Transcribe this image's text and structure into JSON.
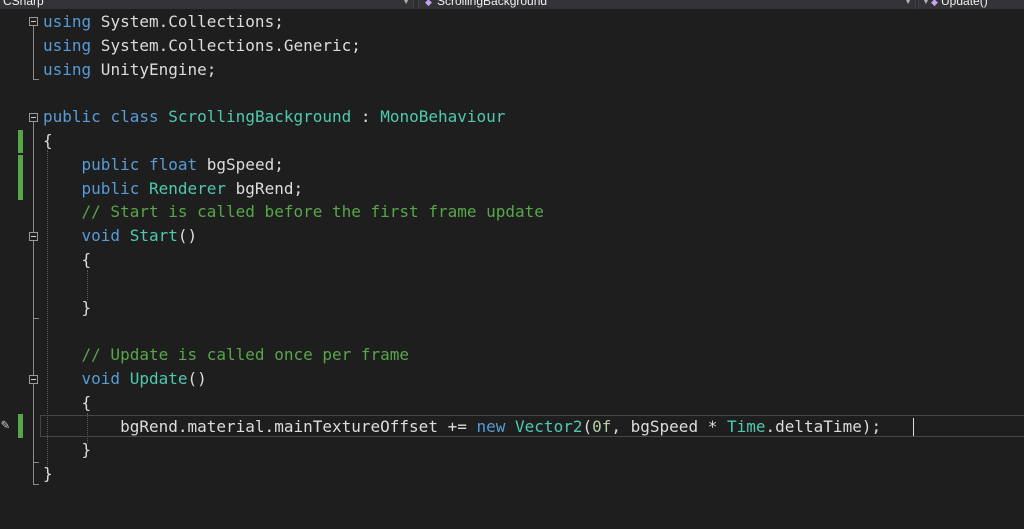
{
  "navbar": {
    "project": "CSharp",
    "class_member": "ScrollingBackground",
    "method": "Update()",
    "colors": {
      "background": "#2d2d30",
      "dropdown": "#333337"
    }
  },
  "editor": {
    "lines": [
      [
        {
          "t": "using",
          "c": "kw"
        },
        {
          "t": " System.Collections;"
        }
      ],
      [
        {
          "t": "using",
          "c": "kw"
        },
        {
          "t": " System.Collections.Generic;"
        }
      ],
      [
        {
          "t": "using",
          "c": "kw"
        },
        {
          "t": " UnityEngine;"
        }
      ],
      [],
      [
        {
          "t": "public",
          "c": "kw"
        },
        {
          "t": " "
        },
        {
          "t": "class",
          "c": "kw"
        },
        {
          "t": " "
        },
        {
          "t": "ScrollingBackground",
          "c": "ty"
        },
        {
          "t": " : "
        },
        {
          "t": "MonoBehaviour",
          "c": "ty"
        }
      ],
      [
        {
          "t": "{"
        }
      ],
      [
        {
          "t": "    "
        },
        {
          "t": "public",
          "c": "kw"
        },
        {
          "t": " "
        },
        {
          "t": "float",
          "c": "kw"
        },
        {
          "t": " bgSpeed;"
        }
      ],
      [
        {
          "t": "    "
        },
        {
          "t": "public",
          "c": "kw"
        },
        {
          "t": " "
        },
        {
          "t": "Renderer",
          "c": "ty"
        },
        {
          "t": " bgRend;"
        }
      ],
      [
        {
          "t": "    "
        },
        {
          "t": "// Start is called before the first frame update",
          "c": "cm"
        }
      ],
      [
        {
          "t": "    "
        },
        {
          "t": "void",
          "c": "kw"
        },
        {
          "t": " "
        },
        {
          "t": "Start",
          "c": "ty"
        },
        {
          "t": "()"
        }
      ],
      [
        {
          "t": "    {"
        }
      ],
      [],
      [
        {
          "t": "    }"
        }
      ],
      [],
      [
        {
          "t": "    "
        },
        {
          "t": "// Update is called once per frame",
          "c": "cm"
        }
      ],
      [
        {
          "t": "    "
        },
        {
          "t": "void",
          "c": "kw"
        },
        {
          "t": " "
        },
        {
          "t": "Update",
          "c": "ty"
        },
        {
          "t": "()"
        }
      ],
      [
        {
          "t": "    {"
        }
      ],
      [
        {
          "t": "        bgRend.material.mainTextureOffset += "
        },
        {
          "t": "new",
          "c": "kw"
        },
        {
          "t": " "
        },
        {
          "t": "Vector2",
          "c": "ty"
        },
        {
          "t": "("
        },
        {
          "t": "0f",
          "c": "nm"
        },
        {
          "t": ", bgSpeed * "
        },
        {
          "t": "Time",
          "c": "ty"
        },
        {
          "t": ".deltaTime);"
        }
      ],
      [
        {
          "t": "    }"
        }
      ],
      [
        {
          "t": "}"
        }
      ]
    ],
    "colors": {
      "background": "#1e1e1e",
      "text": "#dcdcdc",
      "keyword": "#569cd6",
      "type": "#4ec9b0",
      "comment": "#57a64a",
      "number": "#b5cea8",
      "change_marker": "#57a64a"
    },
    "current_line": 18,
    "icons": [
      "collapse-icon",
      "edit-pen-icon"
    ]
  }
}
